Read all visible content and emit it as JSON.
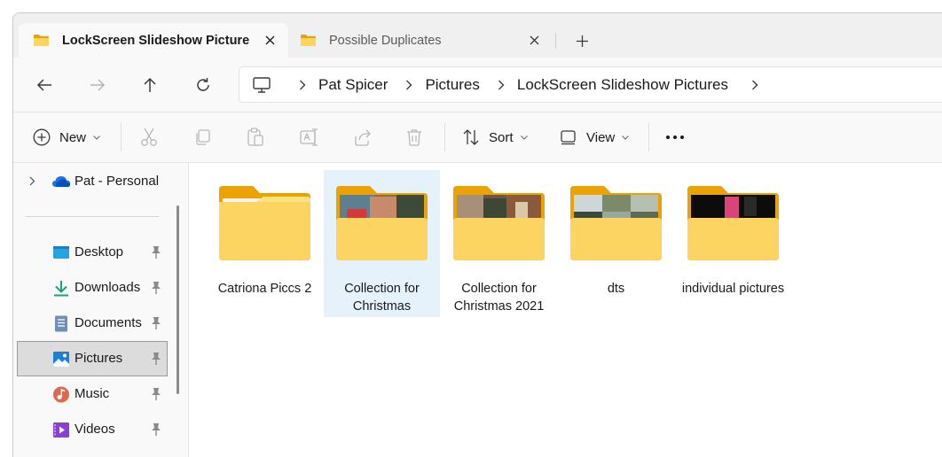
{
  "tabs": [
    {
      "label": "LockScreen Slideshow Picture",
      "active": true
    },
    {
      "label": "Possible Duplicates",
      "active": false
    }
  ],
  "nav": {
    "breadcrumbs": [
      "Pat Spicer",
      "Pictures",
      "LockScreen Slideshow Pictures"
    ]
  },
  "toolbar": {
    "new_label": "New",
    "sort_label": "Sort",
    "view_label": "View"
  },
  "sidebar": {
    "cloud_item": "Pat - Personal",
    "items": [
      {
        "label": "Desktop"
      },
      {
        "label": "Downloads"
      },
      {
        "label": "Documents"
      },
      {
        "label": "Pictures",
        "selected": true
      },
      {
        "label": "Music"
      },
      {
        "label": "Videos"
      }
    ]
  },
  "content": {
    "items": [
      {
        "name": "Catriona Piccs 2"
      },
      {
        "name": "Collection for Christmas",
        "selected": true
      },
      {
        "name": "Collection for Christmas 2021"
      },
      {
        "name": "dts"
      },
      {
        "name": "individual pictures"
      }
    ]
  },
  "colors": {
    "folder_front": "#fcd462",
    "folder_back": "#eaa300",
    "selection": "#e5f1fb",
    "accent": "#0067c0"
  }
}
